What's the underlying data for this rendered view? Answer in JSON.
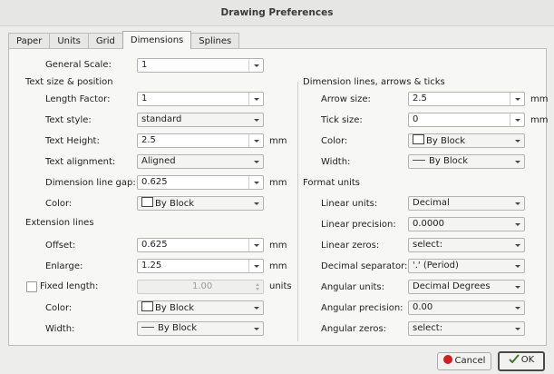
{
  "window": {
    "title": "Drawing Preferences"
  },
  "tabs": [
    {
      "label": "Paper",
      "key": "P"
    },
    {
      "label": "Units",
      "key": "U"
    },
    {
      "label": "Grid",
      "key": "G"
    },
    {
      "label": "Dimensions",
      "key": "D",
      "active": true
    },
    {
      "label": "Splines",
      "key": ""
    }
  ],
  "left": {
    "general_scale": {
      "label": "General Scale:",
      "value": "1"
    },
    "text_section": "Text size & position",
    "length_factor": {
      "label": "Length Factor:",
      "value": "1"
    },
    "text_style": {
      "label": "Text style:",
      "value": "standard"
    },
    "text_height": {
      "label": "Text Height:",
      "value": "2.5",
      "unit": "mm"
    },
    "text_alignment": {
      "label": "Text alignment:",
      "value": "Aligned"
    },
    "dim_line_gap": {
      "label": "Dimension line gap:",
      "value": "0.625",
      "unit": "mm"
    },
    "text_color": {
      "label": "Color:",
      "value": "By Block"
    },
    "ext_section": "Extension lines",
    "offset": {
      "label": "Offset:",
      "value": "0.625",
      "unit": "mm"
    },
    "enlarge": {
      "label": "Enlarge:",
      "value": "1.25",
      "unit": "mm"
    },
    "fixed_length": {
      "label": "Fixed length:",
      "value": "1.00",
      "unit": "units",
      "checked": false
    },
    "ext_color": {
      "label": "Color:",
      "value": "By Block"
    },
    "ext_width": {
      "label": "Width:",
      "value": "By Block"
    }
  },
  "right": {
    "dim_section": "Dimension lines, arrows & ticks",
    "arrow_size": {
      "label": "Arrow size:",
      "value": "2.5",
      "unit": "mm"
    },
    "tick_size": {
      "label": "Tick size:",
      "value": "0",
      "unit": "mm"
    },
    "color": {
      "label": "Color:",
      "value": "By Block"
    },
    "width": {
      "label": "Width:",
      "value": "By Block"
    },
    "format_section": "Format units",
    "linear_units": {
      "label": "Linear units:",
      "value": "Decimal"
    },
    "linear_precision": {
      "label": "Linear precision:",
      "value": "0.0000"
    },
    "linear_zeros": {
      "label": "Linear zeros:",
      "value": "select:"
    },
    "decimal_separator": {
      "label": "Decimal separator:",
      "value": "'.' (Period)"
    },
    "angular_units": {
      "label": "Angular units:",
      "value": "Decimal Degrees"
    },
    "angular_precision": {
      "label": "Angular precision:",
      "value": "0.00"
    },
    "angular_zeros": {
      "label": "Angular zeros:",
      "value": "select:"
    }
  },
  "buttons": {
    "cancel": "Cancel",
    "ok": "OK"
  },
  "colors": {
    "cancel_icon": "#d21e1e",
    "panel_bg": "#f7f7f6"
  }
}
